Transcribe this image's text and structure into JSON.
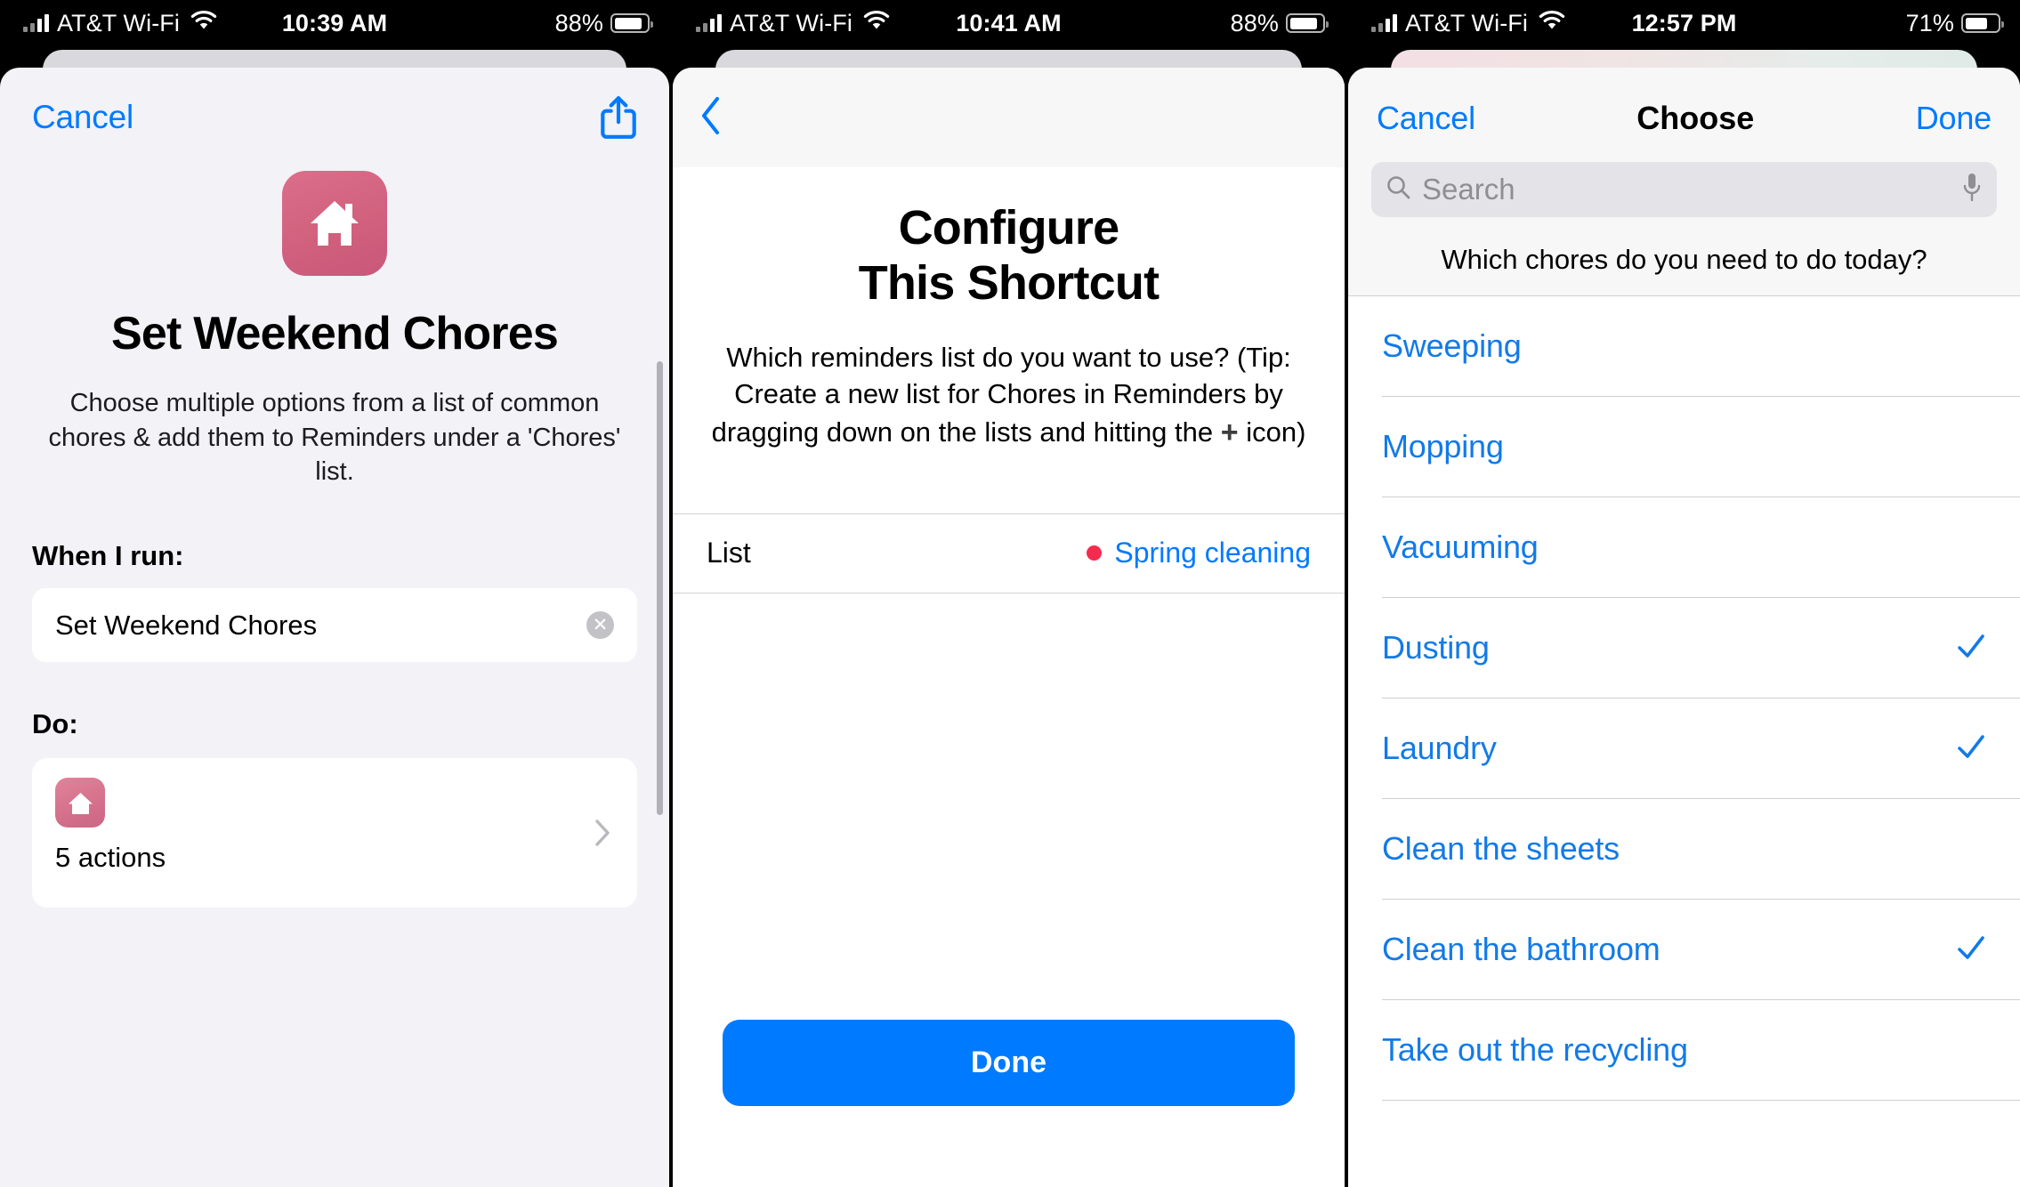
{
  "colors": {
    "ios_blue": "#007aff",
    "link_blue": "#127ae8",
    "shortcut_pink": "#d1617d",
    "reminder_red": "#f52b4e",
    "sheet_lilac": "#f2f2f7",
    "navbar_grey": "#f7f7f8"
  },
  "panel1": {
    "status_bar": {
      "carrier": "AT&T Wi-Fi",
      "wifi_icon": "wifi-icon",
      "signal_icon": "cellular-signal-icon",
      "time": "10:39 AM",
      "battery_percent": "88%",
      "battery_icon": "battery-icon"
    },
    "cancel_label": "Cancel",
    "share_icon": "share-icon",
    "app_icon": "house-icon",
    "title": "Set Weekend Chores",
    "description": "Choose multiple options from a list of common chores & add them to Reminders under a 'Chores' list.",
    "when_i_run_label": "When I run:",
    "shortcut_name_value": "Set Weekend Chores",
    "clear_icon": "clear-field-icon",
    "do_label": "Do:",
    "actions_icon": "house-icon",
    "actions_count_label": "5 actions",
    "disclosure_icon": "chevron-right-icon"
  },
  "panel2": {
    "status_bar": {
      "carrier": "AT&T Wi-Fi",
      "wifi_icon": "wifi-icon",
      "signal_icon": "cellular-signal-icon",
      "time": "10:41 AM",
      "battery_percent": "88%",
      "battery_icon": "battery-icon"
    },
    "back_icon": "chevron-left-icon",
    "title_line1": "Configure",
    "title_line2": "This Shortcut",
    "description_part1": "Which reminders list do you want to use? (Tip: Create a new list for Chores in Reminders by dragging down on the lists and hitting the ",
    "description_plus": "+",
    "description_part2": " icon)",
    "list_row": {
      "key": "List",
      "dot_color": "#f52b4e",
      "value": "Spring cleaning"
    },
    "done_label": "Done"
  },
  "panel3": {
    "status_bar": {
      "carrier": "AT&T Wi-Fi",
      "wifi_icon": "wifi-icon",
      "signal_icon": "cellular-signal-icon",
      "time": "12:57 PM",
      "battery_percent": "71%",
      "battery_icon": "battery-icon"
    },
    "cancel_label": "Cancel",
    "title": "Choose",
    "done_label": "Done",
    "search": {
      "placeholder": "Search",
      "search_icon": "search-icon",
      "mic_icon": "microphone-icon"
    },
    "prompt": "Which chores do you need to do today?",
    "options": [
      {
        "label": "Sweeping",
        "selected": false
      },
      {
        "label": "Mopping",
        "selected": false
      },
      {
        "label": "Vacuuming",
        "selected": false
      },
      {
        "label": "Dusting",
        "selected": true
      },
      {
        "label": "Laundry",
        "selected": true
      },
      {
        "label": "Clean the sheets",
        "selected": false
      },
      {
        "label": "Clean the bathroom",
        "selected": true
      },
      {
        "label": "Take out the recycling",
        "selected": false
      }
    ],
    "check_icon": "checkmark-icon"
  }
}
